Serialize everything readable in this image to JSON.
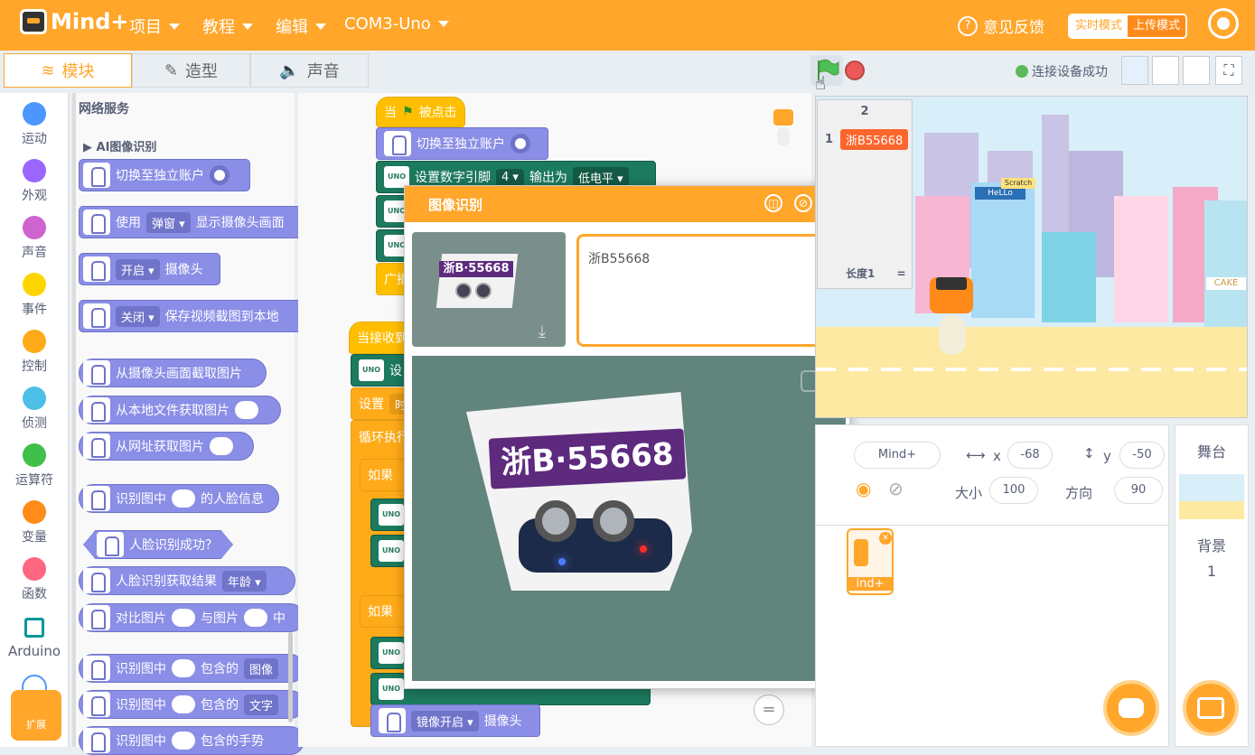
{
  "app": {
    "name": "Mind+"
  },
  "menu": {
    "project": "项目",
    "tutorial": "教程",
    "edit": "编辑",
    "port": "COM3-Uno",
    "feedback": "意见反馈",
    "mode_realtime": "实时模式",
    "mode_upload": "上传模式"
  },
  "tabs": {
    "blocks": "模块",
    "costumes": "造型",
    "sounds": "声音"
  },
  "status": {
    "connected": "连接设备成功"
  },
  "categories": [
    "运动",
    "外观",
    "声音",
    "事件",
    "控制",
    "侦测",
    "运算符",
    "变量",
    "函数",
    "Arduino"
  ],
  "category_colors": [
    "#4c97ff",
    "#9966ff",
    "#cf63cf",
    "#ffd500",
    "#ffab19",
    "#4cbfe6",
    "#40bf4a",
    "#ff8c1a",
    "#ff6680",
    "#00979c"
  ],
  "extension": "扩展",
  "palette": {
    "section": "网络服务",
    "subsection": "AI图像识别",
    "blocks": {
      "switch_account": "切换至独立账户",
      "use": "使用",
      "popup": "弹窗",
      "show_cam": "显示摄像头画面",
      "open": "开启",
      "camera": "摄像头",
      "close": "关闭",
      "save_snapshot": "保存视频截图到本地",
      "from_cam": "从摄像头画面截取图片",
      "from_local": "从本地文件获取图片",
      "from_url": "从网址获取图片",
      "recognize_face_a": "识别图中",
      "recognize_face_b": "的人脸信息",
      "face_success": "人脸识别成功？",
      "face_result": "人脸识别获取结果",
      "age": "年龄",
      "compare_a": "对比图片",
      "compare_b": "与图片",
      "compare_c": "中",
      "contains_a": "识别图中",
      "contains_b": "包含的",
      "contains_img": "图像",
      "contains_text": "文字",
      "contains_gesture": "包含的手势"
    }
  },
  "code": {
    "when_flag_a": "当",
    "when_flag_b": "被点击",
    "switch_account": "切换至独立账户",
    "set_pin": "设置数字引脚",
    "pin_no": "4",
    "output_as": "输出为",
    "low": "低电平",
    "broadcast": "广播",
    "when_receive": "当接收到",
    "set_short": "设",
    "set": "设置",
    "time_short": "时",
    "loop": "循环执行",
    "if": "如果",
    "mirror_open": "镜像开启",
    "camera": "摄像头",
    "equals": "="
  },
  "dialog": {
    "title": "图像识别",
    "result": "浙B55668",
    "plate": "浙B·55668",
    "plate_small": "浙B·55668"
  },
  "monitor": {
    "header": "2",
    "row_index": "1",
    "row_value": "浙B55668",
    "length_label": "长度1",
    "length_eq": "="
  },
  "stage_labels": {
    "hello": "HeLLo",
    "scratch": "Scratch",
    "cake": "CAKE"
  },
  "sprite": {
    "name": "Mind+",
    "x_label": "x",
    "x": "-68",
    "y_label": "y",
    "y": "-50",
    "size_label": "大小",
    "size": "100",
    "dir_label": "方向",
    "dir": "90",
    "thumb_label": "ind+"
  },
  "stage_panel": {
    "title": "舞台",
    "backdrop_label": "背景",
    "backdrop_count": "1"
  }
}
